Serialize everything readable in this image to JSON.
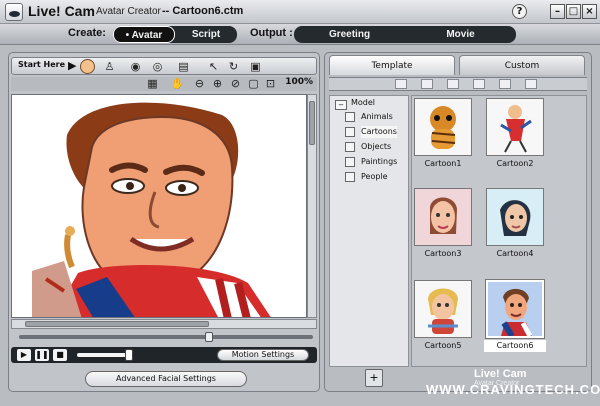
{
  "title": {
    "app_name": "Live! Cam",
    "subtitle": "Avatar Creator",
    "file_name": "-- Cartoon6.ctm",
    "help": "?"
  },
  "mode_bar": {
    "create_label": "Create:",
    "create_tabs": [
      {
        "label": "• Avatar",
        "active": true
      },
      {
        "label": "Script",
        "active": false
      }
    ],
    "output_label": "Output :",
    "output_tabs": [
      {
        "label": "Greeting",
        "active": false
      },
      {
        "label": "Movie",
        "active": false
      }
    ]
  },
  "left_panel": {
    "start_here": "Start Here",
    "zoom": "100%",
    "motion_settings": "Motion Settings",
    "advanced_facial_settings": "Advanced Facial Settings"
  },
  "right_panel": {
    "tabs": [
      {
        "label": "Template",
        "active": true
      },
      {
        "label": "Custom",
        "active": false
      }
    ],
    "tree": {
      "root": "Model",
      "items": [
        {
          "label": "Animals",
          "selected": false
        },
        {
          "label": "Cartoons",
          "selected": true
        },
        {
          "label": "Objects",
          "selected": false
        },
        {
          "label": "Paintings",
          "selected": false
        },
        {
          "label": "People",
          "selected": false
        }
      ]
    },
    "thumbnails": [
      {
        "label": "Cartoon1",
        "selected": false
      },
      {
        "label": "Cartoon2",
        "selected": false
      },
      {
        "label": "Cartoon3",
        "selected": false
      },
      {
        "label": "Cartoon4",
        "selected": false
      },
      {
        "label": "Cartoon5",
        "selected": false
      },
      {
        "label": "Cartoon6",
        "selected": true
      }
    ]
  },
  "brand": {
    "name": "Live! Cam",
    "tagline": "Avatar Creator",
    "watermark": "WWW.CRAVINGTECH.COM"
  },
  "colors": {
    "accent_dark": "#20252a",
    "panel": "#c1c4c8",
    "selected": "#ffffff"
  }
}
